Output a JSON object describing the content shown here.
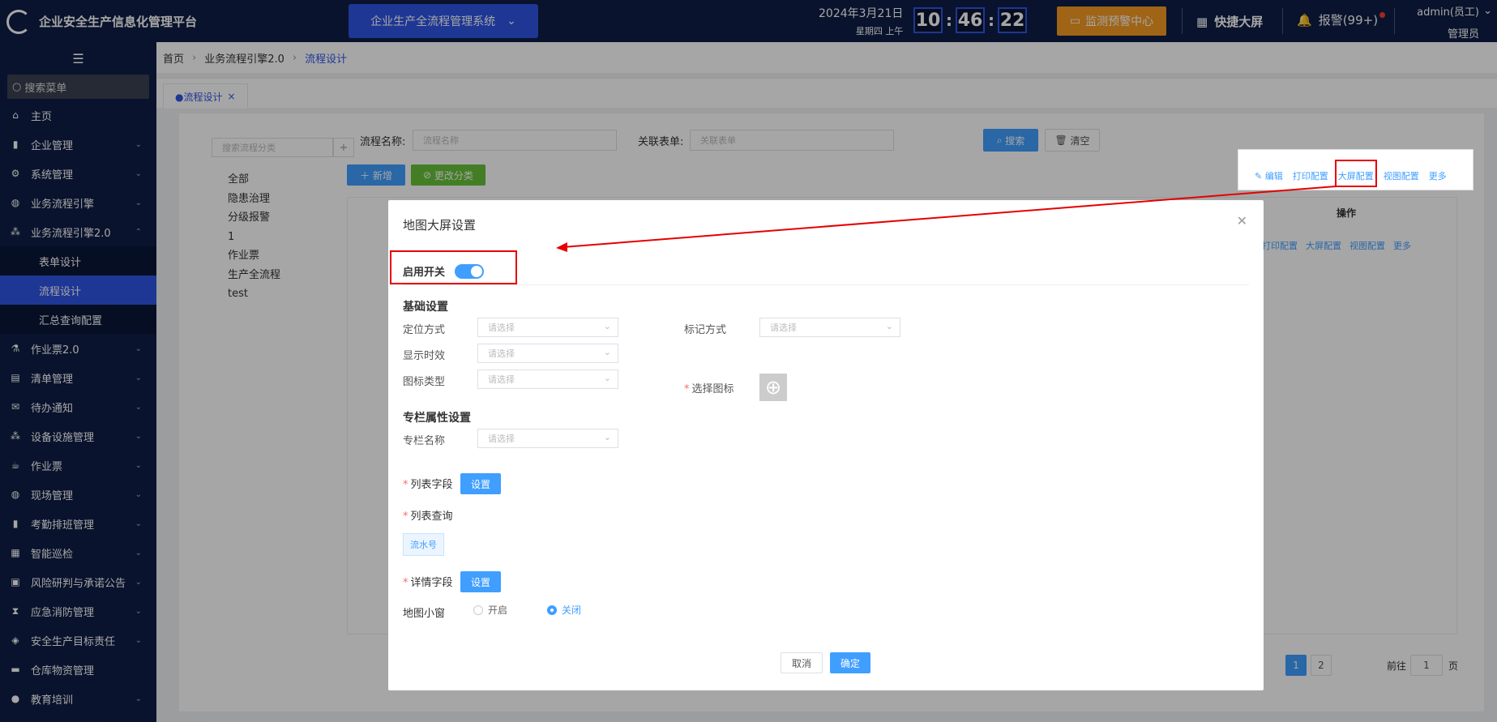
{
  "header": {
    "title": "企业安全生产信息化管理平台",
    "system_select": "企业生产全流程管理系统",
    "date": "2024年3月21日",
    "weekday": "星期四 上午",
    "clock": {
      "h": "10",
      "m": "46",
      "s": "22"
    },
    "monitor_btn": "监测预警中心",
    "quick_screen": "快捷大屏",
    "alarm": "报警(99+)",
    "user_name": "admin(员工)",
    "user_role": "管理员"
  },
  "sidebar": {
    "search_placeholder": "搜索菜单",
    "items": [
      {
        "label": "主页",
        "icon": "home-icon"
      },
      {
        "label": "企业管理",
        "icon": "building-icon"
      },
      {
        "label": "系统管理",
        "icon": "gear-icon"
      },
      {
        "label": "业务流程引擎",
        "icon": "globe-icon"
      },
      {
        "label": "业务流程引擎2.0",
        "icon": "tree-icon"
      },
      {
        "label": "表单设计",
        "icon": ""
      },
      {
        "label": "流程设计",
        "icon": ""
      },
      {
        "label": "汇总查询配置",
        "icon": ""
      },
      {
        "label": "作业票2.0",
        "icon": "flask-icon"
      },
      {
        "label": "清单管理",
        "icon": "list-icon"
      },
      {
        "label": "待办通知",
        "icon": "mail-icon"
      },
      {
        "label": "设备设施管理",
        "icon": "device-icon"
      },
      {
        "label": "作业票",
        "icon": "ticket-icon"
      },
      {
        "label": "现场管理",
        "icon": "globe-icon"
      },
      {
        "label": "考勤排班管理",
        "icon": "chart-icon"
      },
      {
        "label": "智能巡检",
        "icon": "grid-icon"
      },
      {
        "label": "风险研判与承诺公告",
        "icon": "bag-icon"
      },
      {
        "label": "应急消防管理",
        "icon": "fire-icon"
      },
      {
        "label": "安全生产目标责任",
        "icon": "target-icon"
      },
      {
        "label": "仓库物资管理",
        "icon": "warehouse-icon"
      },
      {
        "label": "教育培训",
        "icon": "user-icon"
      }
    ]
  },
  "breadcrumb": {
    "home": "首页",
    "level1": "业务流程引擎2.0",
    "current": "流程设计"
  },
  "tab": {
    "label": "●流程设计",
    "close": "×"
  },
  "list_page": {
    "category_search_placeholder": "搜索流程分类",
    "categories": [
      "全部",
      "隐患治理",
      "分级报警",
      "1",
      "作业票",
      "生产全流程",
      "test"
    ],
    "name_label": "流程名称:",
    "name_placeholder": "流程名称",
    "form_label": "关联表单:",
    "form_placeholder": "关联表单",
    "search_btn": "搜索",
    "clear_btn": "清空",
    "add_btn": "新增",
    "change_cat_btn": "更改分类",
    "ops_header": "操作",
    "row_actions": [
      "编辑",
      "打印配置",
      "大屏配置",
      "视图配置",
      "更多"
    ],
    "pagination": {
      "p1": "1",
      "p2": "2",
      "goto": "前往",
      "page_input": "1",
      "page_unit": "页"
    }
  },
  "popover_actions": [
    "编辑",
    "打印配置",
    "大屏配置",
    "视图配置",
    "更多"
  ],
  "modal": {
    "title": "地图大屏设置",
    "enable_label": "启用开关",
    "basic_section": "基础设置",
    "locate_label": "定位方式",
    "mark_label": "标记方式",
    "display_label": "显示时效",
    "icon_type_label": "图标类型",
    "choose_icon_label": "选择图标",
    "placeholder": "请选择",
    "column_section": "专栏属性设置",
    "column_name_label": "专栏名称",
    "list_field_label": "列表字段",
    "list_query_label": "列表查询",
    "serial_tag": "流水号",
    "detail_field_label": "详情字段",
    "set_btn": "设置",
    "mini_map_label": "地图小窗",
    "open_label": "开启",
    "close_label": "关闭",
    "cancel_btn": "取消",
    "ok_btn": "确定"
  },
  "colors": {
    "nav_bg": "#0f1e45",
    "accent": "#2f55e4",
    "primary": "#409eff",
    "warning": "#f59a23",
    "annotation_red": "#e60000"
  }
}
